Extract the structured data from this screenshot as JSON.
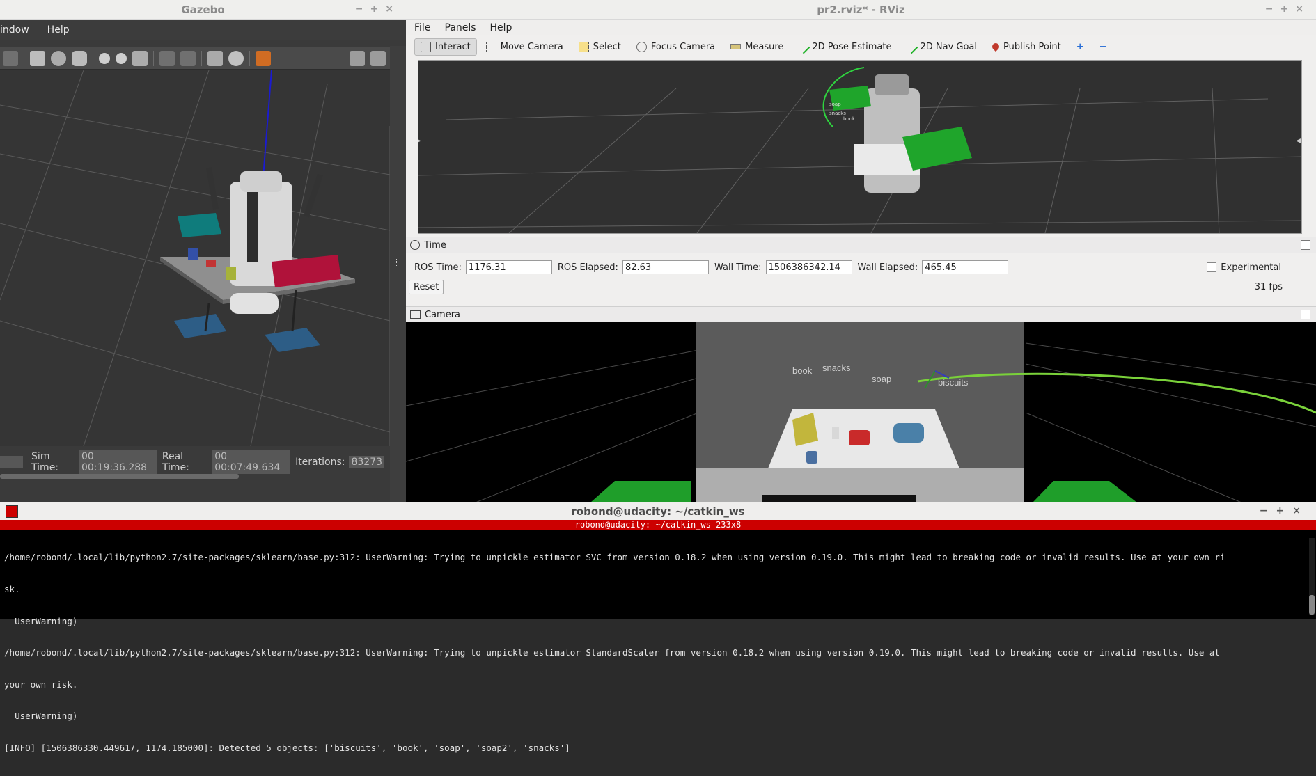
{
  "gazebo": {
    "title": "Gazebo",
    "menu": [
      "indow",
      "Help"
    ],
    "status": {
      "sim_time_label": "Sim Time:",
      "sim_time_value": "00 00:19:36.288",
      "real_time_label": "Real Time:",
      "real_time_value": "00 00:07:49.634",
      "iterations_label": "Iterations:",
      "iterations_value": "83273"
    }
  },
  "rviz": {
    "title": "pr2.rviz* - RViz",
    "menu": [
      "File",
      "Panels",
      "Help"
    ],
    "tools": [
      "Interact",
      "Move Camera",
      "Select",
      "Focus Camera",
      "Measure",
      "2D Pose Estimate",
      "2D Nav Goal",
      "Publish Point"
    ],
    "active_tool": "Interact",
    "time_panel": {
      "title": "Time",
      "ros_time_label": "ROS Time:",
      "ros_time": "1176.31",
      "ros_elapsed_label": "ROS Elapsed:",
      "ros_elapsed": "82.63",
      "wall_time_label": "Wall Time:",
      "wall_time": "1506386342.14",
      "wall_elapsed_label": "Wall Elapsed:",
      "wall_elapsed": "465.45",
      "experimental_label": "Experimental",
      "reset_label": "Reset",
      "fps": "31 fps"
    },
    "view_labels": [
      "soap",
      "snacks",
      "book"
    ],
    "camera_panel": {
      "title": "Camera",
      "labels": [
        "book",
        "snacks",
        "soap",
        "biscuits"
      ]
    }
  },
  "terminal": {
    "title": "robond@udacity: ~/catkin_ws",
    "tab": "robond@udacity: ~/catkin_ws 233x8",
    "lines": [
      "/home/robond/.local/lib/python2.7/site-packages/sklearn/base.py:312: UserWarning: Trying to unpickle estimator SVC from version 0.18.2 when using version 0.19.0. This might lead to breaking code or invalid results. Use at your own ri",
      "sk.",
      "  UserWarning)",
      "/home/robond/.local/lib/python2.7/site-packages/sklearn/base.py:312: UserWarning: Trying to unpickle estimator StandardScaler from version 0.18.2 when using version 0.19.0. This might lead to breaking code or invalid results. Use at",
      "your own risk.",
      "  UserWarning)",
      "[INFO] [1506386330.449617, 1174.185000]: Detected 5 objects: ['biscuits', 'book', 'soap', 'soap2', 'snacks']"
    ]
  },
  "colors": {
    "terminal_tab": "#cc0000",
    "green_marker": "#22c53a"
  }
}
